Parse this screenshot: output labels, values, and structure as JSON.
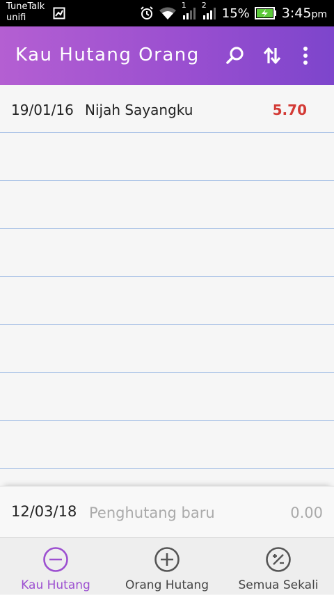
{
  "status_bar": {
    "carrier_line1": "TuneTalk",
    "carrier_line2": "unifi",
    "sim1": "1",
    "sim2": "2",
    "battery": "15%",
    "time": "3:45",
    "ampm": "pm"
  },
  "app_bar": {
    "title": "Kau Hutang Orang",
    "icons": [
      "search-icon",
      "sort-icon",
      "more-vert-icon"
    ]
  },
  "list": {
    "rows": [
      {
        "date": "19/01/16",
        "name": "Nijah Sayangku",
        "amount": "5.70"
      }
    ],
    "empty_row_count": 7
  },
  "entry": {
    "date": "12/03/18",
    "name_placeholder": "Penghutang baru",
    "amount_placeholder": "0.00"
  },
  "bottom_nav": {
    "items": [
      {
        "label": "Kau Hutang",
        "icon": "minus-circle-icon",
        "active": true
      },
      {
        "label": "Orang Hutang",
        "icon": "plus-circle-icon",
        "active": false
      },
      {
        "label": "Semua Sekali",
        "icon": "percent-circle-icon",
        "active": false
      }
    ]
  },
  "colors": {
    "accent": "#9c4fd0",
    "amount_red": "#d33a35",
    "divider_blue": "#a9c2e6"
  }
}
